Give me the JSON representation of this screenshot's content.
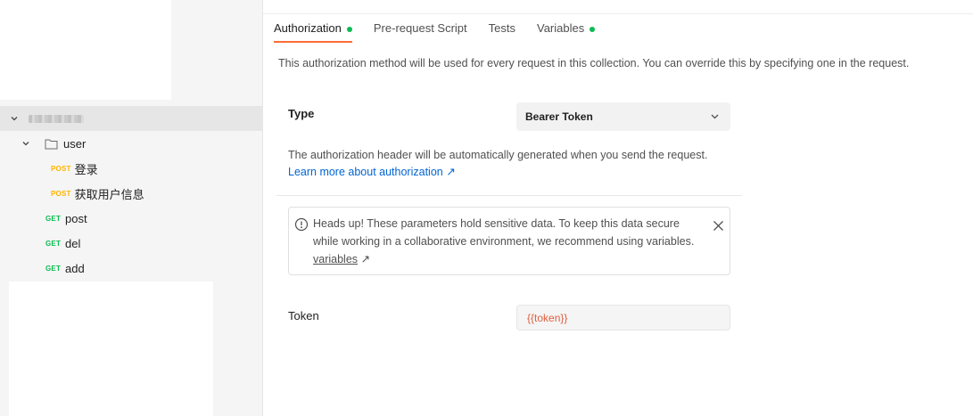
{
  "sidebar": {
    "collection": {
      "name_hidden": true
    },
    "folder": {
      "name": "user"
    },
    "folder_requests": [
      {
        "method": "POST",
        "name": "登录"
      },
      {
        "method": "POST",
        "name": "获取用户信息"
      }
    ],
    "requests": [
      {
        "method": "GET",
        "name": "post"
      },
      {
        "method": "GET",
        "name": "del"
      },
      {
        "method": "GET",
        "name": "add"
      }
    ]
  },
  "tabs": [
    {
      "label": "Authorization",
      "active": true,
      "dot": true
    },
    {
      "label": "Pre-request Script",
      "active": false,
      "dot": false
    },
    {
      "label": "Tests",
      "active": false,
      "dot": false
    },
    {
      "label": "Variables",
      "active": false,
      "dot": true
    }
  ],
  "auth": {
    "description": "This authorization method will be used for every request in this collection. You can override this by specifying one in the request.",
    "type_label": "Type",
    "type_value": "Bearer Token",
    "help_text": "The authorization header will be automatically generated when you send the request.",
    "learn_more": "Learn more about authorization ↗",
    "alert": {
      "text": "Heads up! These parameters hold sensitive data. To keep this data secure while working in a collaborative environment, we recommend using variables.",
      "link": "variables",
      "link_suffix": " ↗"
    },
    "token_label": "Token",
    "token_value": "{{token}}"
  },
  "colors": {
    "accent": "#ff6c37",
    "status_dot": "#0cbb52",
    "post_method": "#ffb400",
    "get_method": "#0cbb52",
    "link": "#0265d2",
    "token_text": "#e05e3f"
  },
  "icons": [
    "chevron-down-icon",
    "folder-icon",
    "info-icon",
    "close-icon",
    "external-link-icon"
  ]
}
